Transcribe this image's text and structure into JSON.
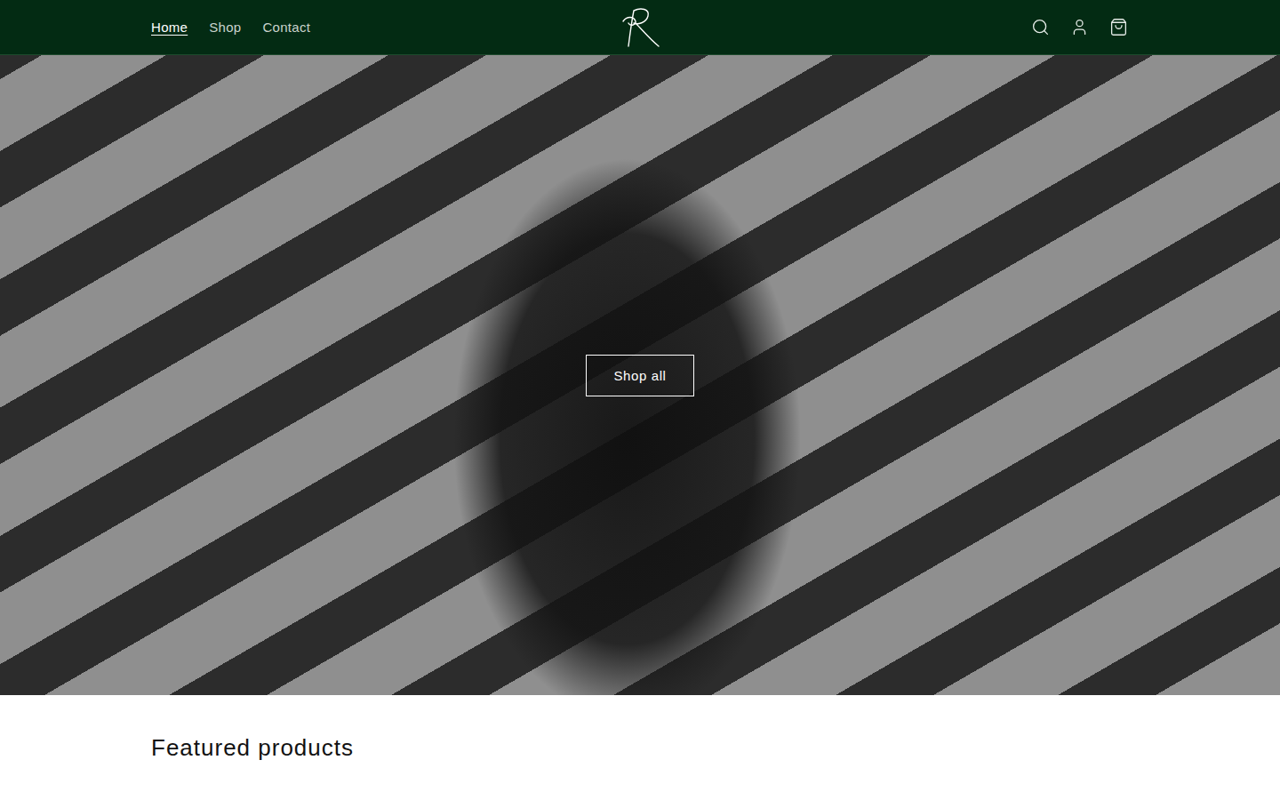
{
  "header": {
    "nav": [
      {
        "label": "Home",
        "selected": true
      },
      {
        "label": "Shop",
        "selected": false
      },
      {
        "label": "Contact",
        "selected": false
      }
    ]
  },
  "hero": {
    "button": "Shop all"
  },
  "featured": {
    "title": "Featured products"
  }
}
